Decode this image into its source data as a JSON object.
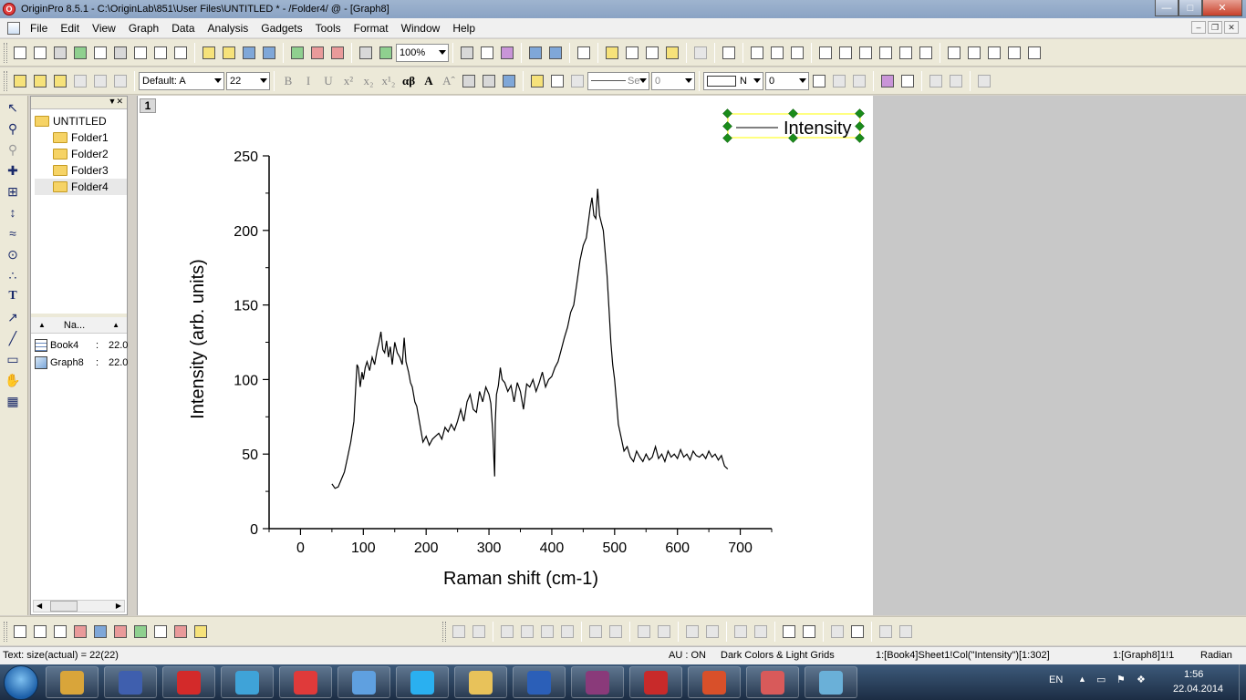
{
  "window": {
    "title": "OriginPro 8.5.1 - C:\\OriginLab\\851\\User Files\\UNTITLED * - /Folder4/ @ - [Graph8]",
    "icon_text": "O"
  },
  "menu": [
    "File",
    "Edit",
    "View",
    "Graph",
    "Data",
    "Analysis",
    "Gadgets",
    "Tools",
    "Format",
    "Window",
    "Help"
  ],
  "toolbar": {
    "zoom": "100%",
    "font_name": "Default: A",
    "font_size": "22",
    "line_style": "Se",
    "line_width": "0",
    "fill_label": "N",
    "pattern_value": "0",
    "format_buttons": [
      "B",
      "I",
      "U",
      "x²",
      "x₂",
      "x¹₂",
      "αβ",
      "A",
      "Aˆ"
    ]
  },
  "project_explorer": {
    "root": "UNTITLED",
    "folders": [
      "Folder1",
      "Folder2",
      "Folder3",
      "Folder4"
    ],
    "list_header": "Na...",
    "items": [
      {
        "name": "Book4",
        "date": "22.0"
      },
      {
        "name": "Graph8",
        "date": "22.0"
      }
    ]
  },
  "graph": {
    "layer": "1",
    "legend": "Intensity",
    "xlabel": "Raman shift (cm-1)",
    "ylabel": "Intensity (arb. units)"
  },
  "chart_data": {
    "type": "line",
    "title": "",
    "xlabel": "Raman shift (cm-1)",
    "ylabel": "Intensity (arb. units)",
    "xlim": [
      -50,
      750
    ],
    "ylim": [
      0,
      250
    ],
    "xticks": [
      0,
      100,
      200,
      300,
      400,
      500,
      600,
      700
    ],
    "yticks": [
      0,
      50,
      100,
      150,
      200,
      250
    ],
    "grid": false,
    "legend_position": "top-right",
    "series": [
      {
        "name": "Intensity",
        "color": "#000000",
        "x": [
          50,
          55,
          60,
          65,
          70,
          75,
          80,
          85,
          88,
          90,
          92,
          95,
          98,
          100,
          103,
          106,
          110,
          114,
          118,
          122,
          125,
          128,
          131,
          134,
          137,
          140,
          143,
          146,
          150,
          154,
          158,
          162,
          165,
          168,
          172,
          175,
          178,
          182,
          185,
          190,
          195,
          200,
          205,
          210,
          215,
          220,
          225,
          230,
          235,
          240,
          245,
          250,
          255,
          260,
          265,
          270,
          275,
          280,
          285,
          290,
          295,
          300,
          303,
          306,
          309,
          310,
          312,
          315,
          318,
          321,
          325,
          330,
          335,
          340,
          345,
          350,
          355,
          360,
          365,
          370,
          375,
          380,
          385,
          390,
          395,
          400,
          405,
          410,
          415,
          420,
          425,
          430,
          435,
          440,
          445,
          450,
          455,
          458,
          461,
          464,
          467,
          470,
          473,
          476,
          479,
          482,
          485,
          488,
          491,
          494,
          497,
          500,
          503,
          506,
          510,
          515,
          520,
          525,
          530,
          535,
          540,
          545,
          550,
          555,
          560,
          565,
          570,
          575,
          580,
          585,
          590,
          595,
          600,
          605,
          610,
          615,
          620,
          625,
          630,
          635,
          640,
          645,
          650,
          655,
          660,
          665,
          670,
          675,
          680
        ],
        "y": [
          30,
          27,
          28,
          33,
          38,
          48,
          58,
          72,
          95,
          110,
          108,
          95,
          105,
          100,
          108,
          112,
          106,
          115,
          110,
          120,
          125,
          132,
          120,
          118,
          126,
          115,
          122,
          110,
          125,
          118,
          115,
          110,
          128,
          112,
          105,
          98,
          95,
          85,
          82,
          70,
          58,
          62,
          56,
          60,
          62,
          64,
          60,
          68,
          65,
          70,
          66,
          72,
          80,
          72,
          85,
          90,
          80,
          78,
          92,
          85,
          95,
          90,
          84,
          65,
          35,
          72,
          90,
          96,
          108,
          100,
          98,
          92,
          96,
          85,
          98,
          92,
          80,
          97,
          95,
          100,
          92,
          98,
          105,
          95,
          100,
          102,
          108,
          112,
          120,
          128,
          135,
          145,
          150,
          165,
          180,
          190,
          195,
          205,
          215,
          222,
          210,
          208,
          228,
          210,
          205,
          200,
          185,
          170,
          148,
          125,
          110,
          100,
          85,
          70,
          62,
          52,
          55,
          48,
          45,
          52,
          48,
          45,
          50,
          46,
          48,
          55,
          47,
          50,
          45,
          52,
          48,
          50,
          47,
          53,
          48,
          50,
          46,
          52,
          49,
          48,
          50,
          47,
          52,
          48,
          50,
          46,
          49,
          42,
          40
        ]
      }
    ]
  },
  "status": {
    "left": "Text: size(actual) = 22(22)",
    "au": "AU : ON",
    "theme": "Dark Colors & Light Grids",
    "column": "1:[Book4]Sheet1!Col(\"Intensity\")[1:302]",
    "graph": "1:[Graph8]1!1",
    "angle": "Radian"
  },
  "taskbar": {
    "lang": "EN",
    "time": "1:56",
    "date": "22.04.2014",
    "apps": [
      {
        "name": "chrome",
        "color": "#d9a53a"
      },
      {
        "name": "save",
        "color": "#3f5fae"
      },
      {
        "name": "opera",
        "color": "#d32a2a"
      },
      {
        "name": "music",
        "color": "#3fa3d8"
      },
      {
        "name": "yandex",
        "color": "#e03a3a"
      },
      {
        "name": "speaker",
        "color": "#5fa0e0"
      },
      {
        "name": "skype",
        "color": "#2ab0f0"
      },
      {
        "name": "explorer",
        "color": "#e8c25a"
      },
      {
        "name": "word",
        "color": "#2b5fb8"
      },
      {
        "name": "winrar",
        "color": "#8a3a7a"
      },
      {
        "name": "acrobat",
        "color": "#c82a2a"
      },
      {
        "name": "powerpoint",
        "color": "#d8502a"
      },
      {
        "name": "origin",
        "color": "#d85a5a"
      },
      {
        "name": "notes",
        "color": "#6ab0d8"
      }
    ]
  }
}
